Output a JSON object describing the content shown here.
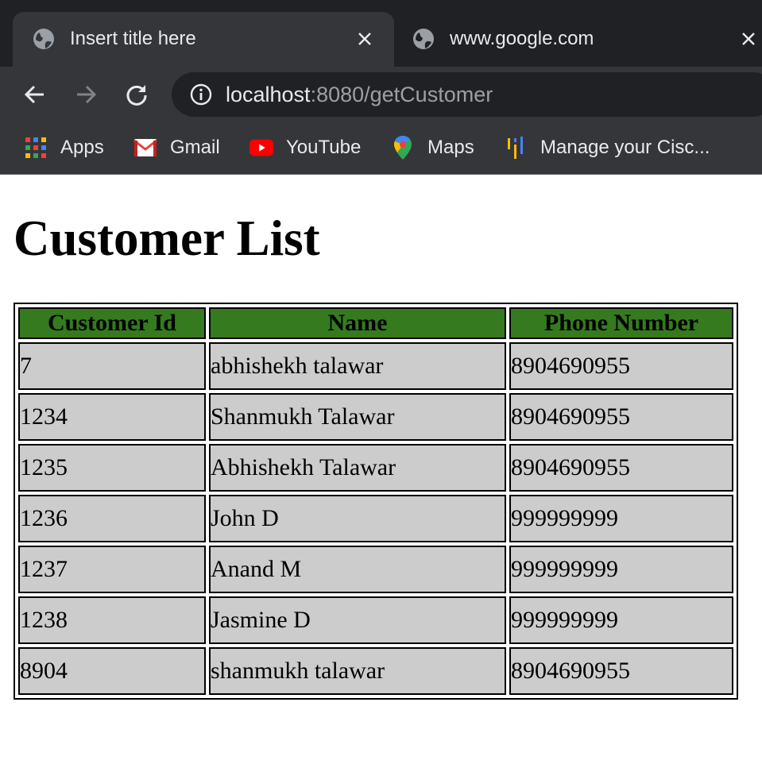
{
  "browser": {
    "tabs": [
      {
        "title": "Insert title here",
        "active": true
      },
      {
        "title": "www.google.com",
        "active": false
      }
    ],
    "address_bar": {
      "host": "localhost",
      "rest": ":8080/getCustomer"
    },
    "bookmarks": [
      {
        "label": "Apps",
        "icon": "apps-grid-icon"
      },
      {
        "label": "Gmail",
        "icon": "gmail-icon"
      },
      {
        "label": "YouTube",
        "icon": "youtube-icon"
      },
      {
        "label": "Maps",
        "icon": "maps-pin-icon"
      },
      {
        "label": "Manage your Cisc...",
        "icon": "cisco-icon"
      }
    ],
    "colors": {
      "tabstrip": "#202124",
      "toolbar": "#35363a",
      "text": "#e8eaed"
    }
  },
  "page": {
    "title": "Customer List",
    "table": {
      "headers": [
        "Customer Id",
        "Name",
        "Phone Number"
      ],
      "rows": [
        [
          "7",
          "abhishekh talawar",
          "8904690955"
        ],
        [
          "1234",
          "Shanmukh Talawar",
          "8904690955"
        ],
        [
          "1235",
          "Abhishekh Talawar",
          "8904690955"
        ],
        [
          "1236",
          "John D",
          "999999999"
        ],
        [
          "1237",
          "Anand M",
          "999999999"
        ],
        [
          "1238",
          "Jasmine D",
          "999999999"
        ],
        [
          "8904",
          "shanmukh talawar",
          "8904690955"
        ]
      ],
      "header_color": "#357a1f",
      "cell_color": "#cccccc"
    }
  }
}
